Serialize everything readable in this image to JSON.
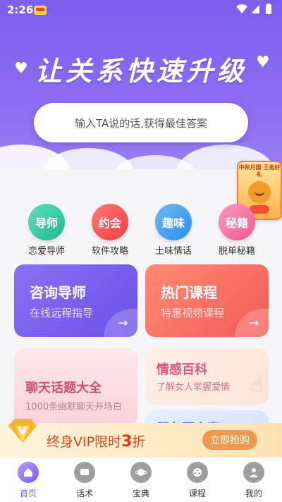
{
  "status_bar": {
    "time": "2:26"
  },
  "header": {
    "headline": "让关系快速升级",
    "search_placeholder": "输入TA说的话,获得最佳答案"
  },
  "promo_badge": {
    "text": "中秋月圆 王者好礼"
  },
  "quick_nav": [
    {
      "circle": "导师",
      "label": "恋爱导师",
      "color": "#2fc3a0"
    },
    {
      "circle": "约会",
      "label": "软件攻略",
      "color": "#f2504f"
    },
    {
      "circle": "趣味",
      "label": "土味情话",
      "color": "#3e9df0"
    },
    {
      "circle": "秘籍",
      "label": "脱单秘籍",
      "color": "#f46c9b"
    }
  ],
  "cards": {
    "consult": {
      "title": "咨询导师",
      "subtitle": "在线远程指导",
      "color": "#7a5df0"
    },
    "courses": {
      "title": "热门课程",
      "subtitle": "特惠视频课程",
      "color": "#f7715f"
    },
    "topics": {
      "title": "聊天话题大全",
      "subtitle": "1000条幽默聊天开场白"
    },
    "encyclopedia": {
      "title": "情感百科",
      "subtitle": "了解女人掌握爱情"
    },
    "moments": {
      "title": "朋友圈文案"
    }
  },
  "vip_bar": {
    "text_prefix": "终身VIP限时",
    "text_number": "3",
    "text_suffix": "折",
    "button": "立即抢购",
    "badge_letter": "V"
  },
  "tabbar": [
    {
      "label": "首页",
      "active": true
    },
    {
      "label": "话术"
    },
    {
      "label": "宝典"
    },
    {
      "label": "课程"
    },
    {
      "label": "我的"
    }
  ]
}
